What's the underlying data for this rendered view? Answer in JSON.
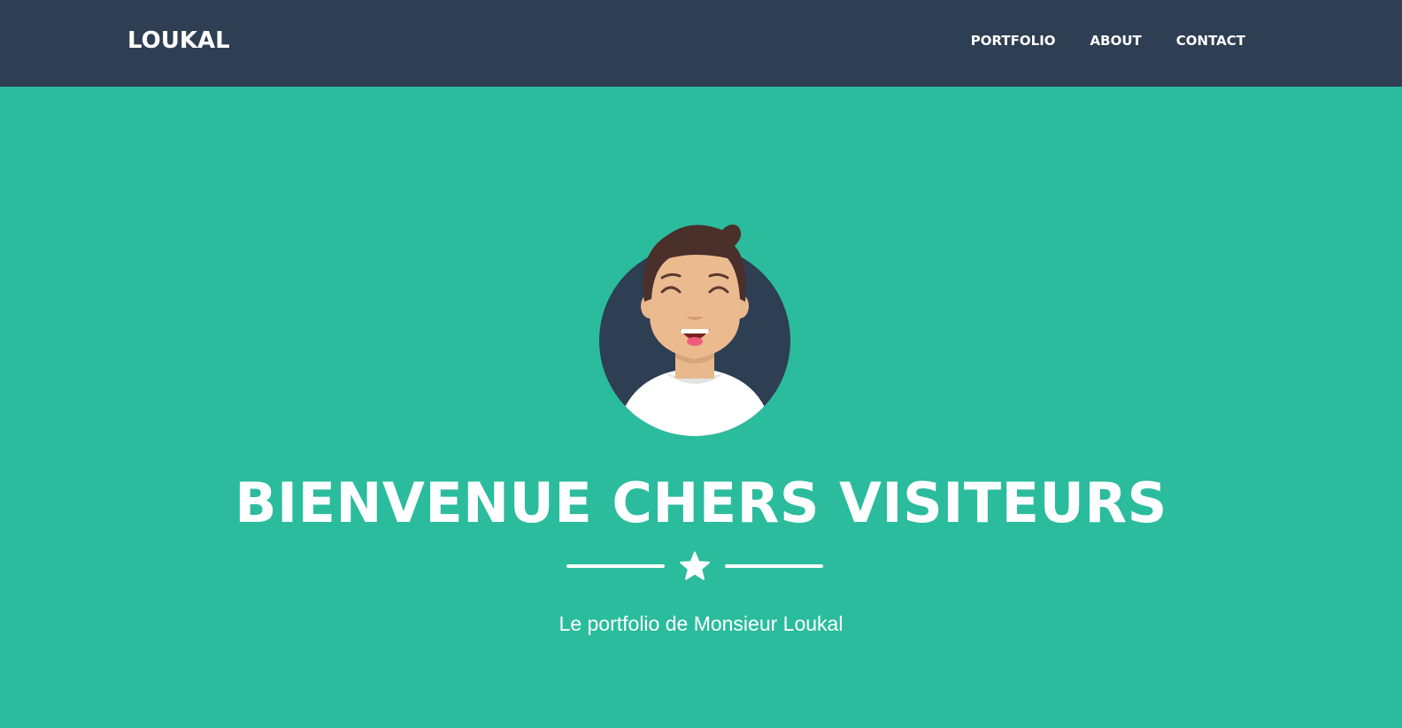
{
  "navbar": {
    "brand": "LOUKAL",
    "links": [
      {
        "label": "PORTFOLIO"
      },
      {
        "label": "ABOUT"
      },
      {
        "label": "CONTACT"
      }
    ]
  },
  "hero": {
    "avatar_icon": "smiling-person-avatar-icon",
    "headline": "BIENVENUE CHERS VISITEURS",
    "divider_icon": "star-icon",
    "tagline": "Le portfolio de Monsieur Loukal"
  },
  "colors": {
    "navbar_bg": "#2e3e53",
    "hero_bg": "#2bbc9d",
    "text": "#ffffff"
  }
}
